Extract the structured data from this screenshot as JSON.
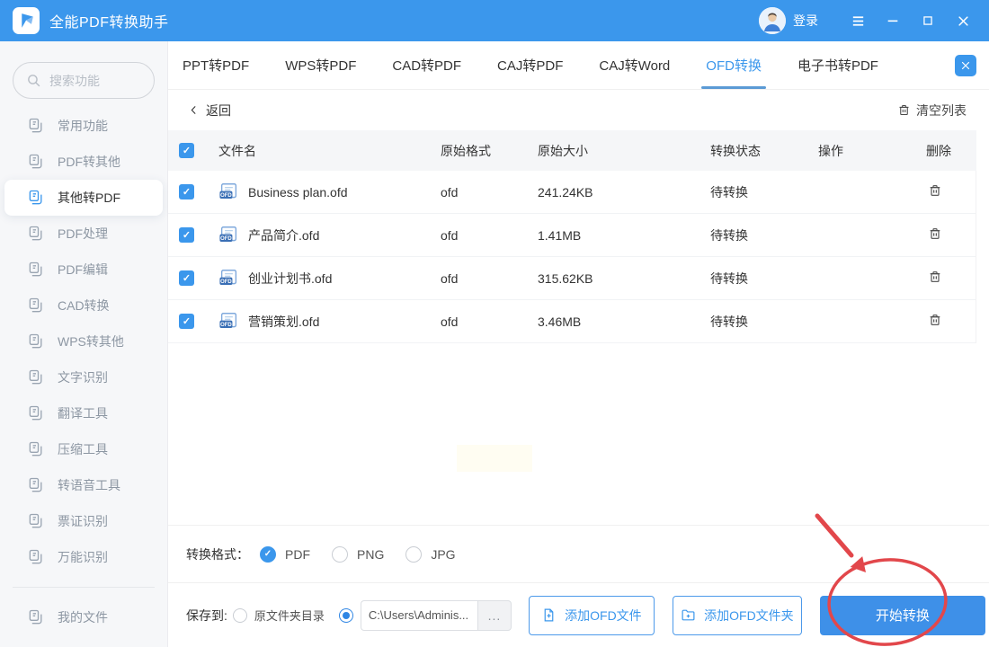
{
  "colors": {
    "accent": "#3B97EC",
    "tab_underline": "#5B9BD5",
    "primary_button": "#3E90E8",
    "annotation_red": "#E2474B",
    "sidebar_bg": "#f6f7f9"
  },
  "titlebar": {
    "app_title": "全能PDF转换助手",
    "login_label": "登录",
    "icons": [
      "app-logo",
      "avatar",
      "menu-icon",
      "minimize-icon",
      "maximize-icon",
      "close-icon"
    ]
  },
  "sidebar": {
    "search_placeholder": "搜索功能",
    "items": [
      {
        "label": "常用功能",
        "active": false
      },
      {
        "label": "PDF转其他",
        "active": false
      },
      {
        "label": "其他转PDF",
        "active": true
      },
      {
        "label": "PDF处理",
        "active": false
      },
      {
        "label": "PDF编辑",
        "active": false
      },
      {
        "label": "CAD转换",
        "active": false
      },
      {
        "label": "WPS转其他",
        "active": false
      },
      {
        "label": "文字识别",
        "active": false
      },
      {
        "label": "翻译工具",
        "active": false
      },
      {
        "label": "压缩工具",
        "active": false
      },
      {
        "label": "转语音工具",
        "active": false
      },
      {
        "label": "票证识别",
        "active": false
      },
      {
        "label": "万能识别",
        "active": false
      }
    ],
    "footer_item": {
      "label": "我的文件",
      "active": false
    }
  },
  "tabs": [
    {
      "label": "PPT转PDF",
      "active": false
    },
    {
      "label": "WPS转PDF",
      "active": false
    },
    {
      "label": "CAD转PDF",
      "active": false
    },
    {
      "label": "CAJ转PDF",
      "active": false
    },
    {
      "label": "CAJ转Word",
      "active": false
    },
    {
      "label": "OFD转换",
      "active": true
    },
    {
      "label": "电子书转PDF",
      "active": false
    }
  ],
  "toolbar": {
    "back_label": "返回",
    "clear_list_label": "清空列表"
  },
  "table": {
    "headers": [
      "文件名",
      "原始格式",
      "原始大小",
      "转换状态",
      "操作",
      "删除"
    ],
    "rows": [
      {
        "name": "Business plan.ofd",
        "format": "ofd",
        "size": "241.24KB",
        "status": "待转换",
        "checked": true
      },
      {
        "name": "产品简介.ofd",
        "format": "ofd",
        "size": "1.41MB",
        "status": "待转换",
        "checked": true
      },
      {
        "name": "创业计划书.ofd",
        "format": "ofd",
        "size": "315.62KB",
        "status": "待转换",
        "checked": true
      },
      {
        "name": "营销策划.ofd",
        "format": "ofd",
        "size": "3.46MB",
        "status": "待转换",
        "checked": true
      }
    ]
  },
  "format_bar": {
    "label": "转换格式：",
    "options": [
      {
        "label": "PDF",
        "selected": true
      },
      {
        "label": "PNG",
        "selected": false
      },
      {
        "label": "JPG",
        "selected": false
      }
    ]
  },
  "bottom_bar": {
    "save_label": "保存到:",
    "save_option_original": "原文件夹目录",
    "save_option_original_selected": false,
    "save_option_custom_selected": true,
    "path_value": "C:\\Users\\Adminis...",
    "browse_label": "...",
    "add_file_button": "添加OFD文件",
    "add_folder_button": "添加OFD文件夹",
    "start_button": "开始转换"
  }
}
